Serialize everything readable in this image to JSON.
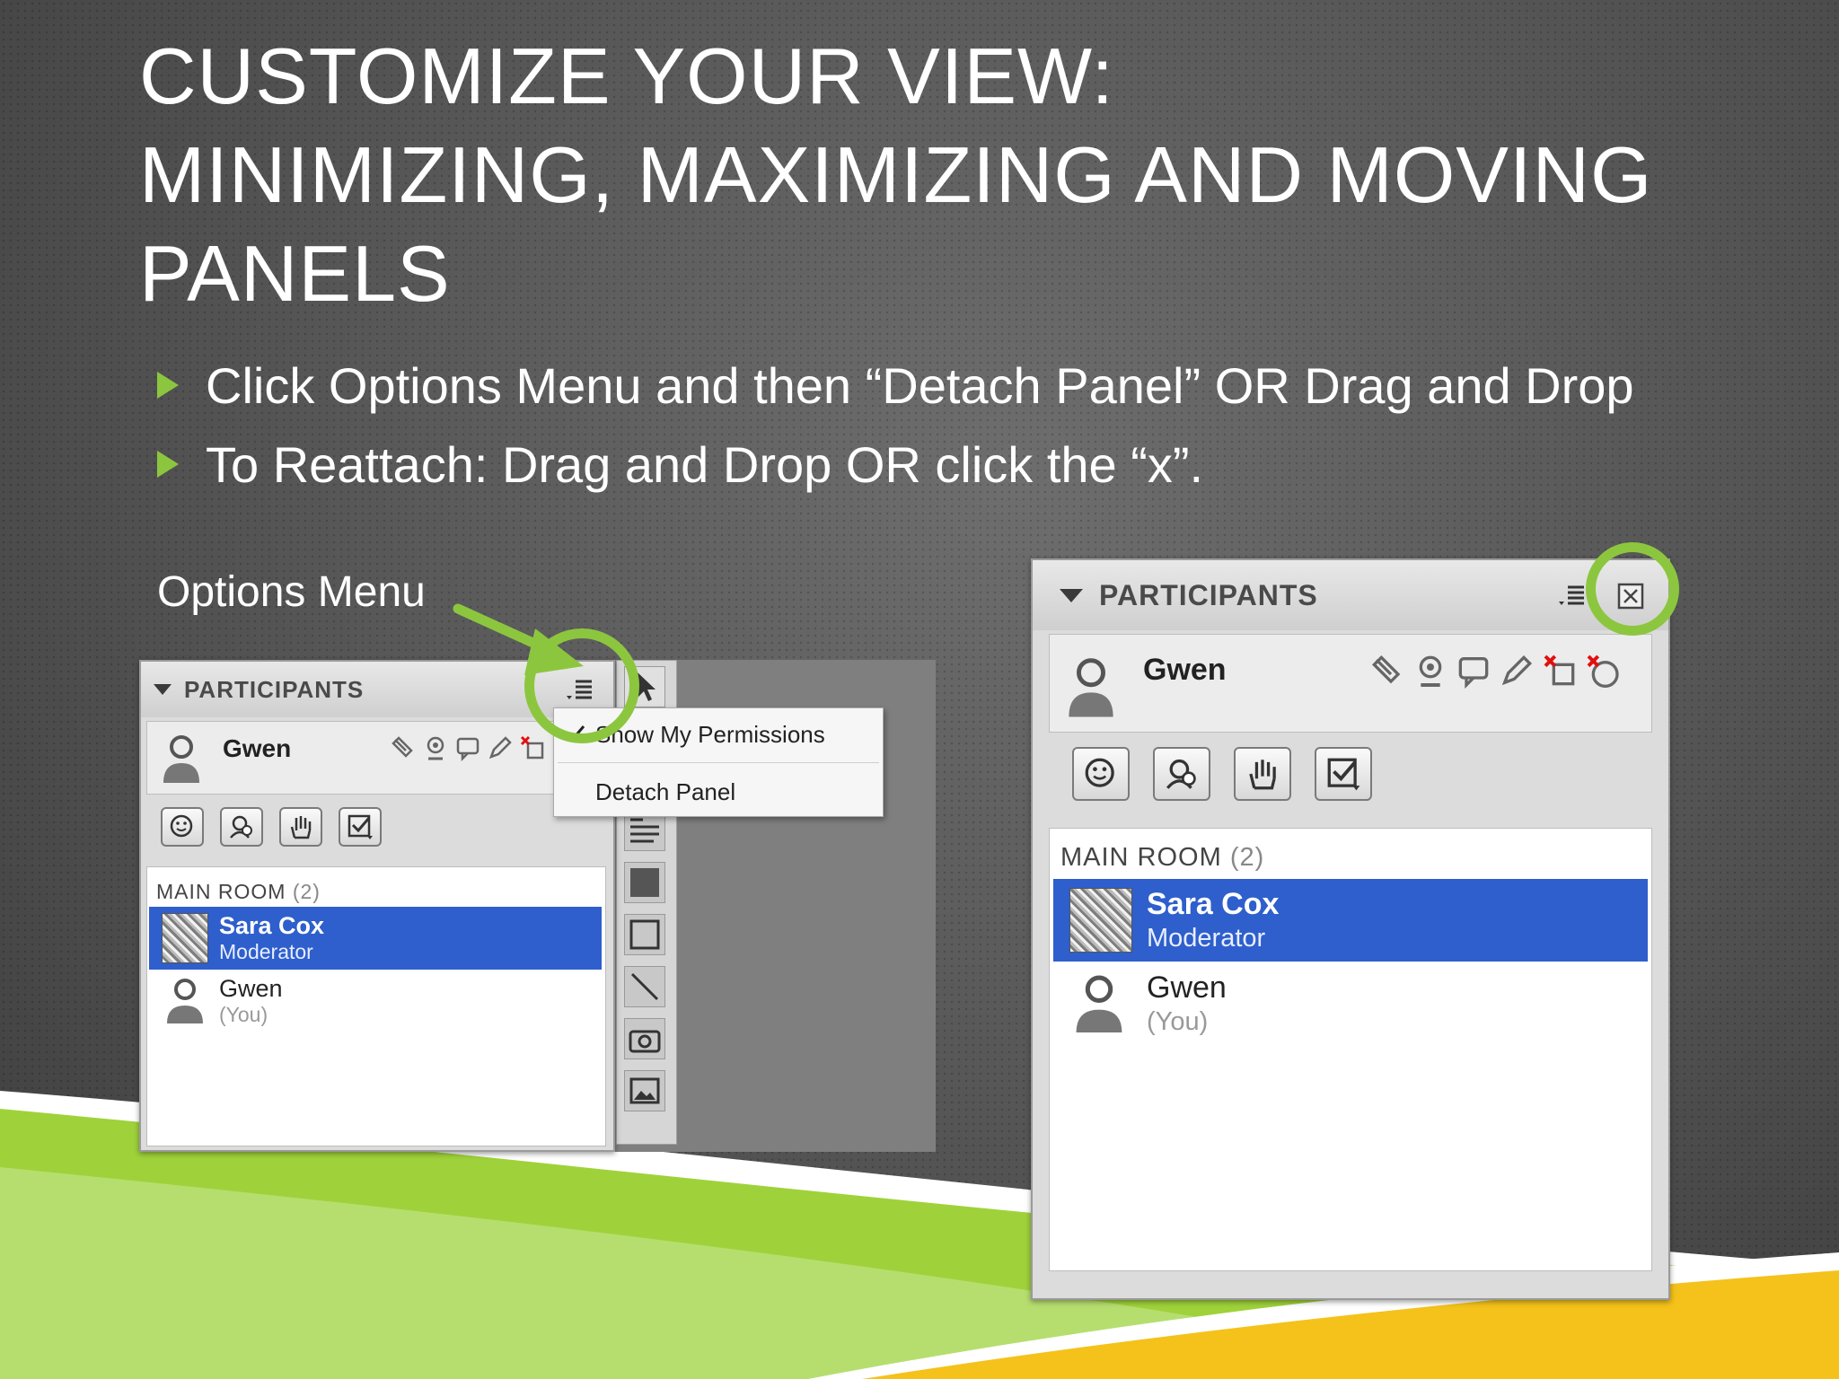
{
  "slide": {
    "title_lines": [
      "CUSTOMIZE YOUR VIEW:",
      "MINIMIZING, MAXIMIZING AND MOVING",
      "PANELS"
    ],
    "bullets": [
      "Click Options Menu and then “Detach Panel” OR Drag and Drop",
      "To Reattach: Drag and Drop OR click the “x”."
    ],
    "callout_label": "Options Menu",
    "accent_color": "#8cc63f"
  },
  "left_panel": {
    "header": "PARTICIPANTS",
    "user": "Gwen",
    "room_label": "MAIN ROOM",
    "room_count": "(2)",
    "participants": [
      {
        "name": "Sara Cox",
        "role": "Moderator"
      },
      {
        "name": "Gwen",
        "role": "(You)"
      }
    ],
    "menu_items": [
      "Show My Permissions",
      "Detach Panel"
    ]
  },
  "right_panel": {
    "header": "PARTICIPANTS",
    "user": "Gwen",
    "room_label": "MAIN ROOM",
    "room_count": "(2)",
    "participants": [
      {
        "name": "Sara Cox",
        "role": "Moderator"
      },
      {
        "name": "Gwen",
        "role": "(You)"
      }
    ]
  },
  "icons": {
    "options_menu": "options-menu-icon",
    "close": "close-icon",
    "tools": [
      "emoticon-icon",
      "profile-icon",
      "raise-hand-icon",
      "poll-icon"
    ]
  }
}
